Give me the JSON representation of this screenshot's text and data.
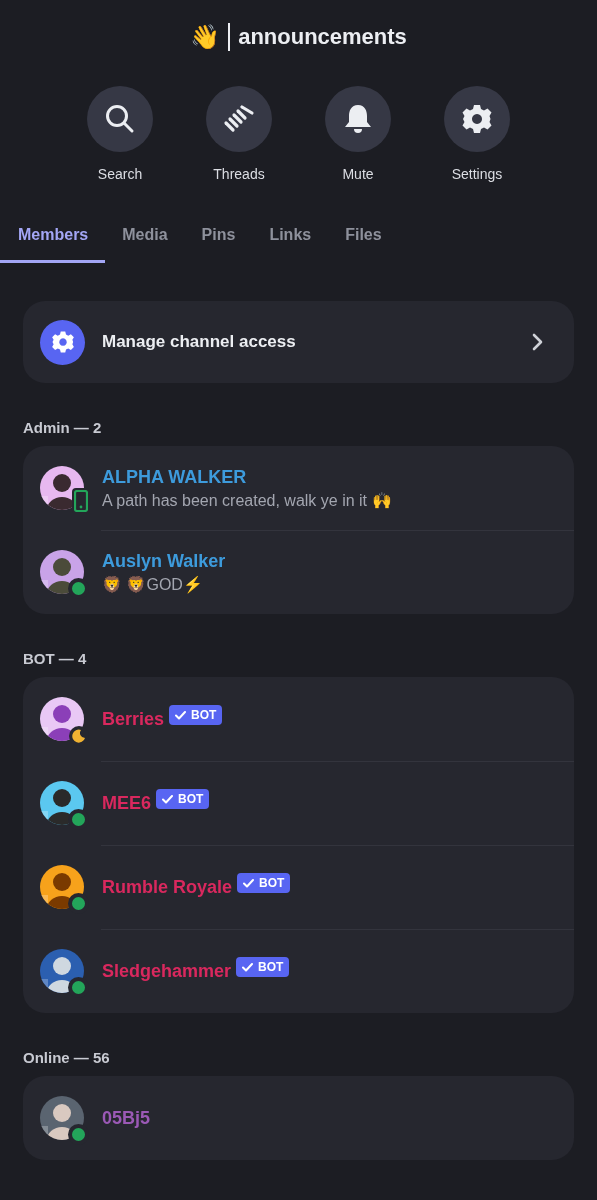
{
  "header": {
    "emoji": "👋",
    "title": "announcements"
  },
  "actions": [
    {
      "label": "Search"
    },
    {
      "label": "Threads"
    },
    {
      "label": "Mute"
    },
    {
      "label": "Settings"
    }
  ],
  "tabs": [
    {
      "label": "Members",
      "selected": true
    },
    {
      "label": "Media",
      "selected": false
    },
    {
      "label": "Pins",
      "selected": false
    },
    {
      "label": "Links",
      "selected": false
    },
    {
      "label": "Files",
      "selected": false
    }
  ],
  "manage": {
    "label": "Manage channel access"
  },
  "sections": [
    {
      "title": "Admin — 2",
      "members": [
        {
          "name": "ALPHA WALKER",
          "color": "#3d9bdc",
          "kind": "mobile",
          "subtitle": "A path has been created, walk ye in it 🙌"
        },
        {
          "name": "Auslyn Walker",
          "color": "#3d9bdc",
          "kind": "online",
          "subtitle": "🦁 🦁GOD⚡"
        }
      ]
    },
    {
      "title": "BOT — 4",
      "members": [
        {
          "name": "Berries",
          "color": "#d9285e",
          "kind": "idle",
          "tag": "BOT"
        },
        {
          "name": "MEE6",
          "color": "#d9285e",
          "kind": "online",
          "tag": "BOT"
        },
        {
          "name": "Rumble Royale",
          "color": "#d9285e",
          "kind": "online",
          "tag": "BOT"
        },
        {
          "name": "Sledgehammer",
          "color": "#d9285e",
          "kind": "online",
          "tag": "BOT"
        }
      ]
    },
    {
      "title": "Online — 56",
      "members": [
        {
          "name": "05Bj5",
          "color": "#9b59b6",
          "kind": "online"
        }
      ]
    }
  ]
}
